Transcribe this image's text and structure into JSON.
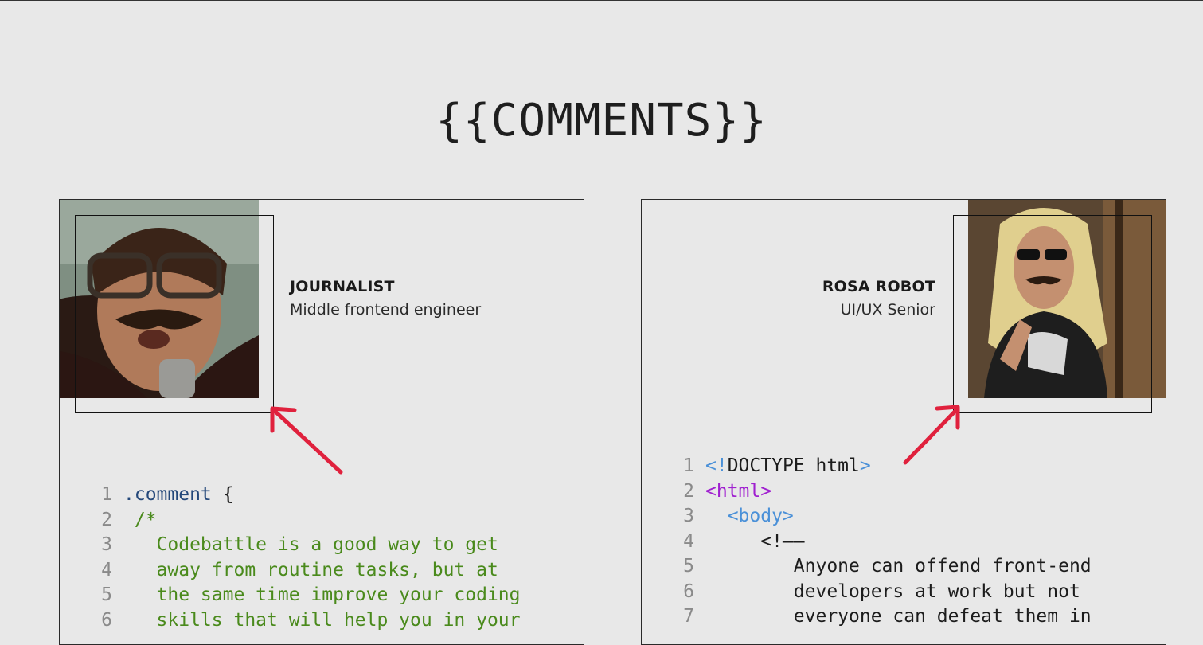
{
  "page": {
    "title": "{{COMMENTS}}"
  },
  "comments": [
    {
      "author": "JOURNALIST",
      "role": "Middle frontend engineer",
      "code_lines": [
        {
          "n": "1",
          "parts": [
            {
              "t": ".comment",
              "c": "c-sel"
            },
            {
              "t": " {",
              "c": "c-brace"
            }
          ]
        },
        {
          "n": "2",
          "parts": [
            {
              "t": " /*",
              "c": "c-comment"
            }
          ]
        },
        {
          "n": "3",
          "parts": [
            {
              "t": "   Codebattle is a good way to get",
              "c": "c-comment"
            }
          ]
        },
        {
          "n": "4",
          "parts": [
            {
              "t": "   away from routine tasks, but at",
              "c": "c-comment"
            }
          ]
        },
        {
          "n": "5",
          "parts": [
            {
              "t": "   the same time improve your coding",
              "c": "c-comment"
            }
          ]
        },
        {
          "n": "6",
          "parts": [
            {
              "t": "   skills that will help you in your",
              "c": "c-comment"
            }
          ]
        }
      ]
    },
    {
      "author": "ROSA ROBOT",
      "role": "UI/UX Senior",
      "code_lines": [
        {
          "n": "1",
          "parts": [
            {
              "t": "<!",
              "c": "c-tag-blue"
            },
            {
              "t": "DOCTYPE html",
              "c": "c-text"
            },
            {
              "t": ">",
              "c": "c-tag-blue"
            }
          ]
        },
        {
          "n": "2",
          "parts": [
            {
              "t": "<html>",
              "c": "c-tag-purple"
            }
          ]
        },
        {
          "n": "3",
          "parts": [
            {
              "t": "  <body>",
              "c": "c-tag-blue"
            }
          ]
        },
        {
          "n": "4",
          "parts": [
            {
              "t": "     <!——",
              "c": "c-text"
            }
          ]
        },
        {
          "n": "5",
          "parts": [
            {
              "t": "        Anyone can offend front-end",
              "c": "c-text"
            }
          ]
        },
        {
          "n": "6",
          "parts": [
            {
              "t": "        developers at work but not",
              "c": "c-text"
            }
          ]
        },
        {
          "n": "7",
          "parts": [
            {
              "t": "        everyone can defeat them in",
              "c": "c-text"
            }
          ]
        }
      ]
    }
  ],
  "colors": {
    "background": "#e8e8e8",
    "arrow": "#e0213d",
    "comment_green": "#4a8a1c",
    "tag_blue": "#4a90d8",
    "tag_purple": "#a020d0"
  }
}
